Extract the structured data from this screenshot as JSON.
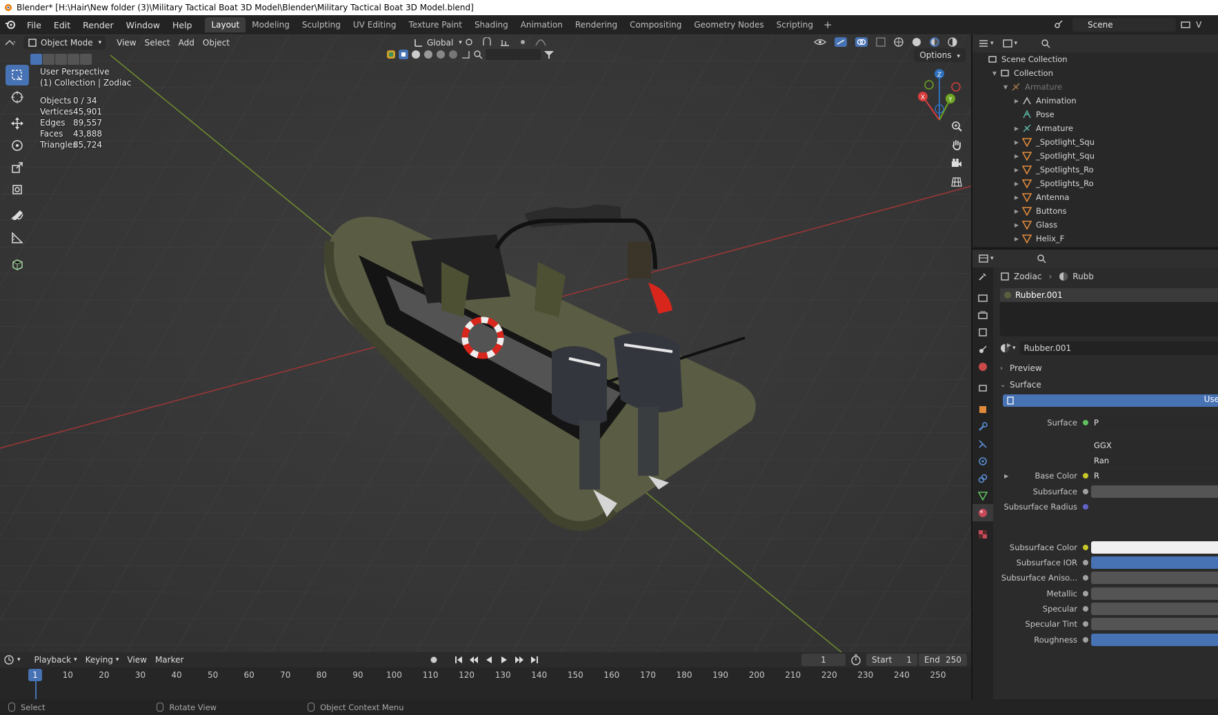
{
  "window": {
    "title": "Blender* [H:\\Hair\\New folder (3)\\Military Tactical Boat 3D Model\\Blender\\Military Tactical Boat 3D Model.blend]"
  },
  "menu": {
    "items": [
      "File",
      "Edit",
      "Render",
      "Window",
      "Help"
    ]
  },
  "workspaces": {
    "tabs": [
      "Layout",
      "Modeling",
      "Sculpting",
      "UV Editing",
      "Texture Paint",
      "Shading",
      "Animation",
      "Rendering",
      "Compositing",
      "Geometry Nodes",
      "Scripting"
    ],
    "active": "Layout",
    "add": "+"
  },
  "scene": {
    "name": "Scene",
    "viewlayer_prefix": "V"
  },
  "viewport": {
    "mode": "Object Mode",
    "menus": [
      "View",
      "Select",
      "Add",
      "Object"
    ],
    "orientation": "Global",
    "options_label": "Options",
    "perspective": "User Perspective",
    "context": "(1) Collection | Zodiac",
    "stats": [
      {
        "label": "Objects",
        "value": "0 / 34"
      },
      {
        "label": "Vertices",
        "value": "45,901"
      },
      {
        "label": "Edges",
        "value": "89,557"
      },
      {
        "label": "Faces",
        "value": "43,888"
      },
      {
        "label": "Triangles",
        "value": "85,724"
      }
    ],
    "gizmo": {
      "x": "X",
      "y": "Y",
      "z": "Z"
    }
  },
  "timeline": {
    "menus": [
      "Playback",
      "Keying",
      "View",
      "Marker"
    ],
    "current_frame": "1",
    "start_label": "Start",
    "start": "1",
    "end_label": "End",
    "end": "250",
    "ticks": [
      "10",
      "20",
      "30",
      "40",
      "50",
      "60",
      "70",
      "80",
      "90",
      "100",
      "110",
      "120",
      "130",
      "140",
      "150",
      "160",
      "170",
      "180",
      "190",
      "200",
      "210",
      "220",
      "230",
      "240",
      "250"
    ]
  },
  "status": {
    "select": "Select",
    "rotate": "Rotate View",
    "context_menu": "Object Context Menu"
  },
  "outliner": {
    "rows": [
      {
        "label": "Scene Collection",
        "icon": "scene-collection-icon"
      },
      {
        "label": "Collection",
        "icon": "collection-icon"
      },
      {
        "label": "Armature",
        "icon": "armature-icon"
      },
      {
        "label": "Animation",
        "icon": "animation-icon"
      },
      {
        "label": "Pose",
        "icon": "pose-icon"
      },
      {
        "label": "Armature",
        "icon": "armature-data-icon"
      },
      {
        "label": "_Spotlight_Squ",
        "icon": "mesh-icon"
      },
      {
        "label": "_Spotlight_Squ",
        "icon": "mesh-icon"
      },
      {
        "label": "_Spotlights_Ro",
        "icon": "mesh-icon"
      },
      {
        "label": "_Spotlights_Ro",
        "icon": "mesh-icon"
      },
      {
        "label": "Antenna",
        "icon": "mesh-icon"
      },
      {
        "label": "Buttons",
        "icon": "mesh-icon"
      },
      {
        "label": "Glass",
        "icon": "mesh-icon"
      },
      {
        "label": "Helix_F",
        "icon": "mesh-icon"
      }
    ]
  },
  "properties": {
    "breadcrumb": {
      "object": "Zodiac",
      "material": "Rubb"
    },
    "slot": "Rubber.001",
    "material": "Rubber.001",
    "panels": {
      "preview": "Preview",
      "surface": "Surface"
    },
    "use_nodes": "Use",
    "fields": [
      {
        "label": "Surface",
        "value": "P",
        "dot": "#5fbf5f"
      },
      {
        "label": "",
        "value": "GGX",
        "dot": ""
      },
      {
        "label": "",
        "value": "Ran",
        "dot": ""
      },
      {
        "label": "Base Color",
        "value": "R",
        "dot": "#c7c729"
      },
      {
        "label": "Subsurface",
        "value": "",
        "dot": "#a1a1a1"
      },
      {
        "label": "Subsurface Radius",
        "value": "",
        "dot": "#6363c7"
      },
      {
        "label": "Subsurface Color",
        "value": "",
        "dot": "#c7c729"
      },
      {
        "label": "Subsurface IOR",
        "value": "",
        "dot": "#a1a1a1"
      },
      {
        "label": "Subsurface Aniso...",
        "value": "",
        "dot": "#a1a1a1"
      },
      {
        "label": "Metallic",
        "value": "",
        "dot": "#a1a1a1"
      },
      {
        "label": "Specular",
        "value": "",
        "dot": "#a1a1a1"
      },
      {
        "label": "Specular Tint",
        "value": "",
        "dot": "#a1a1a1"
      },
      {
        "label": "Roughness",
        "value": "",
        "dot": "#a1a1a1"
      }
    ]
  }
}
